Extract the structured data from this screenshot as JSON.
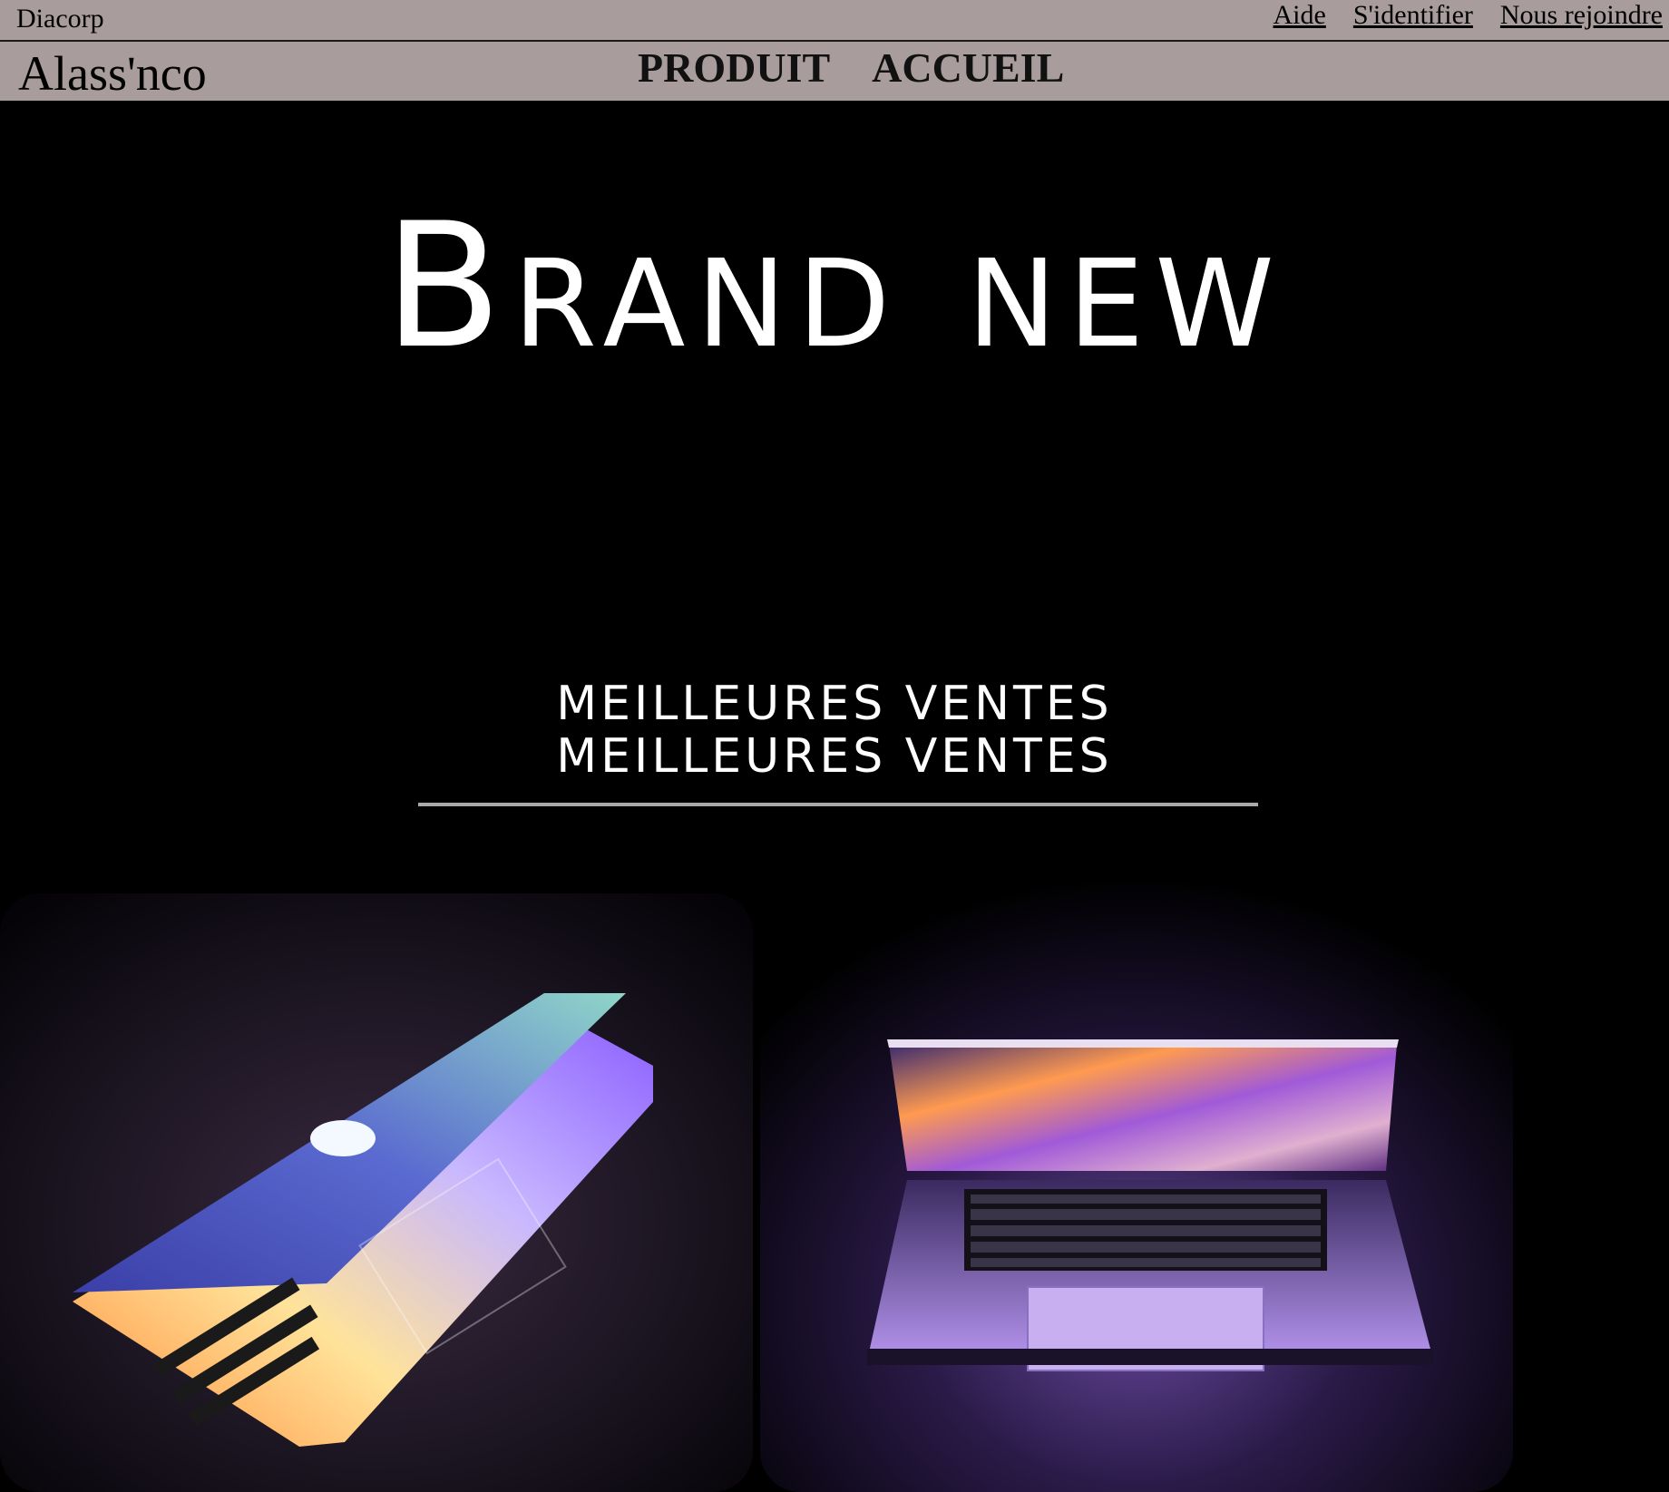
{
  "topbar": {
    "brand": "Diacorp",
    "links": [
      "Aide",
      "S'identifier",
      "Nous rejoindre"
    ]
  },
  "navbar": {
    "logo": "Alass'nco",
    "items": [
      "PRODUIT",
      "ACCUEIL"
    ]
  },
  "hero": {
    "title": "Brand new"
  },
  "section": {
    "heading_line1": "meilleures ventes",
    "heading_line2": "meilleures ventes"
  },
  "colors": {
    "bar_bg": "#a89c9c",
    "page_bg": "#000000",
    "text_light": "#ffffff"
  }
}
